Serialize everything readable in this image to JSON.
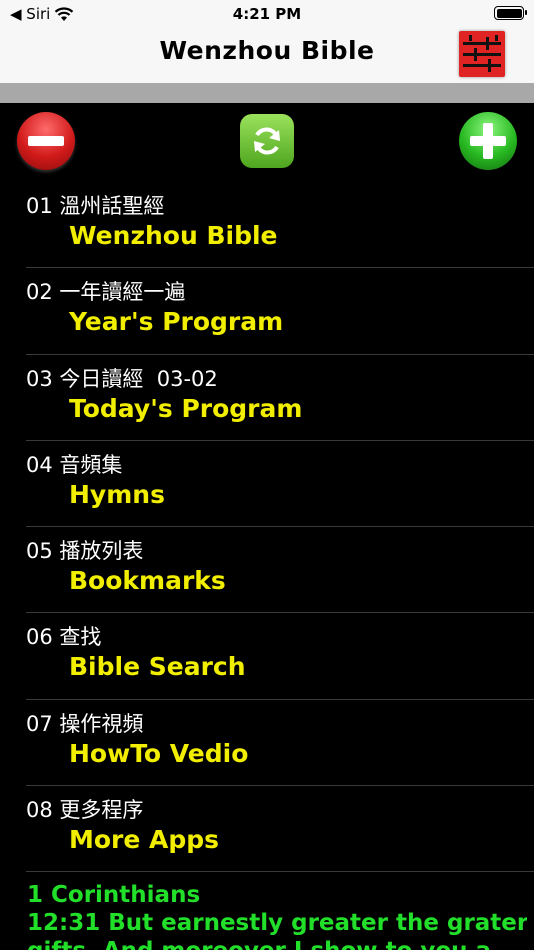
{
  "status_bar": {
    "back_label": "◀ Siri",
    "time": "4:21 PM",
    "battery_level": 1.0
  },
  "nav": {
    "title": "Wenzhou Bible"
  },
  "toolbar": {
    "remove_icon": "minus-circle-icon",
    "refresh_icon": "refresh-icon",
    "add_icon": "plus-circle-icon"
  },
  "menu": [
    {
      "title": "01 溫州話聖經",
      "subtitle": "Wenzhou Bible"
    },
    {
      "title": "02 一年讀經一遍",
      "subtitle": "Year's Program"
    },
    {
      "title": "03 今日讀經  03-02",
      "subtitle": "Today's Program"
    },
    {
      "title": "04 音頻集",
      "subtitle": "Hymns"
    },
    {
      "title": "05 播放列表",
      "subtitle": "Bookmarks"
    },
    {
      "title": "06 查找",
      "subtitle": "Bible Search"
    },
    {
      "title": "07 操作視頻",
      "subtitle": "HowTo Vedio"
    },
    {
      "title": "08 更多程序",
      "subtitle": "More Apps"
    }
  ],
  "verse": {
    "book": "1 Corinthians",
    "text_line1": "12:31 But earnestly greater the grater",
    "text_line2": "gifts. And moreover I show to you a"
  },
  "colors": {
    "menu_subtitle": "#f2ee00",
    "verse_text": "#22e02a",
    "settings_button": "#e02424"
  }
}
